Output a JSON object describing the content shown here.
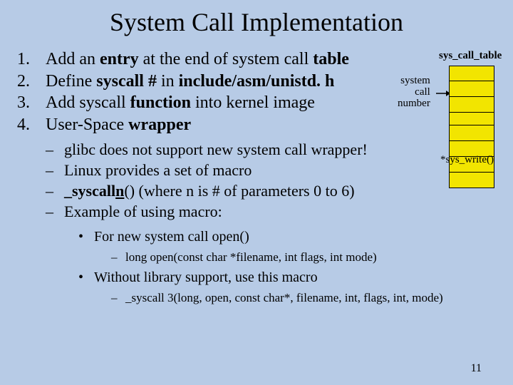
{
  "title": "System Call Implementation",
  "items": [
    {
      "num": "1.",
      "pre": "Add an ",
      "bold1": "entry",
      "mid": " at the end of system call ",
      "bold2": "table"
    },
    {
      "num": "2.",
      "pre": "Define ",
      "bold1": "syscall #",
      "mid": " in ",
      "bold2": "include/asm/unistd. h"
    },
    {
      "num": "3.",
      "pre": "Add syscall ",
      "bold1": "function",
      "mid": " into  kernel image",
      "bold2": ""
    },
    {
      "num": "4.",
      "pre": "User-Space ",
      "bold1": "wrapper",
      "mid": "",
      "bold2": ""
    }
  ],
  "sub1": [
    "glibc does not  support new system call wrapper!",
    "Linux provides a set of macro",
    "",
    "Example of using macro:"
  ],
  "sub1_special": {
    "pre": "_syscall",
    "bold": "n",
    "post": "()  (where n is # of parameters 0 to 6)"
  },
  "sub2": [
    "For new system call  open()",
    "Without library support, use this macro"
  ],
  "sub3": [
    "long open(const char *filename, int flags, int mode)",
    "_syscall 3(long, open, const char*, filename, int, flags, int, mode)"
  ],
  "diagram": {
    "table_label": "sys_call_table",
    "scn": "system\ncall\nnumber",
    "sys_write": "*sys_write()"
  },
  "page_number": "11"
}
